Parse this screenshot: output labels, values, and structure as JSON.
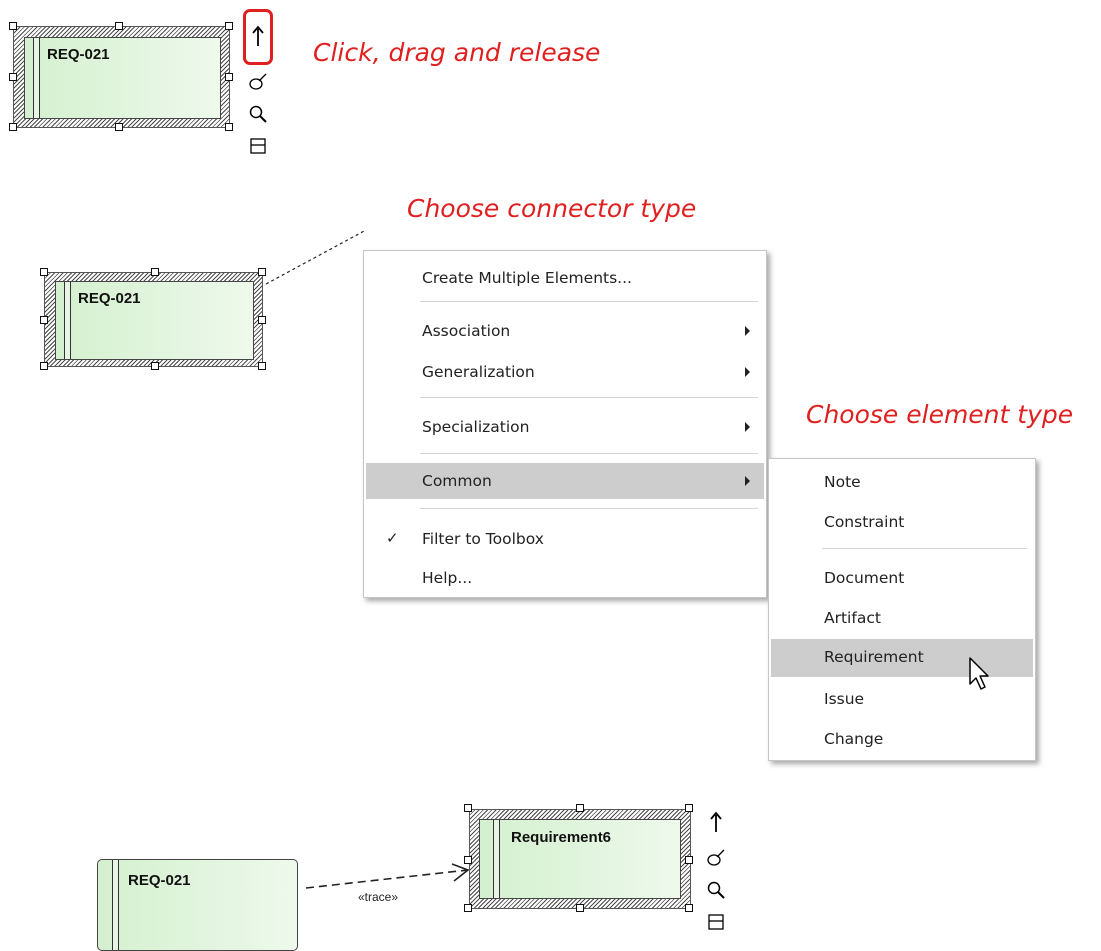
{
  "step1": {
    "element_name": "REQ-021",
    "callout": "Click, drag and release",
    "icons": [
      "up-arrow-icon",
      "brush-icon",
      "magnifier-icon",
      "window-icon"
    ]
  },
  "step2": {
    "element_name": "REQ-021",
    "callout_connector": "Choose connector type",
    "callout_element": "Choose element type",
    "menu": {
      "items": [
        "Create Multiple Elements...",
        "Association",
        "Generalization",
        "Specialization",
        "Common",
        "Filter to Toolbox",
        "Help..."
      ],
      "highlighted": "Common",
      "checked": "Filter to Toolbox"
    },
    "submenu": {
      "items": [
        "Note",
        "Constraint",
        "Document",
        "Artifact",
        "Requirement",
        "Issue",
        "Change"
      ],
      "highlighted": "Requirement"
    }
  },
  "step3": {
    "source_name": "REQ-021",
    "target_name": "Requirement6",
    "connector_label": "«trace»",
    "icons": [
      "up-arrow-icon",
      "brush-icon",
      "magnifier-icon",
      "window-icon"
    ]
  },
  "colors": {
    "callout": "#e02020",
    "element_fill": "#d4f0cf",
    "highlight": "#cdcdcd",
    "selection_outline": "#e02020"
  }
}
